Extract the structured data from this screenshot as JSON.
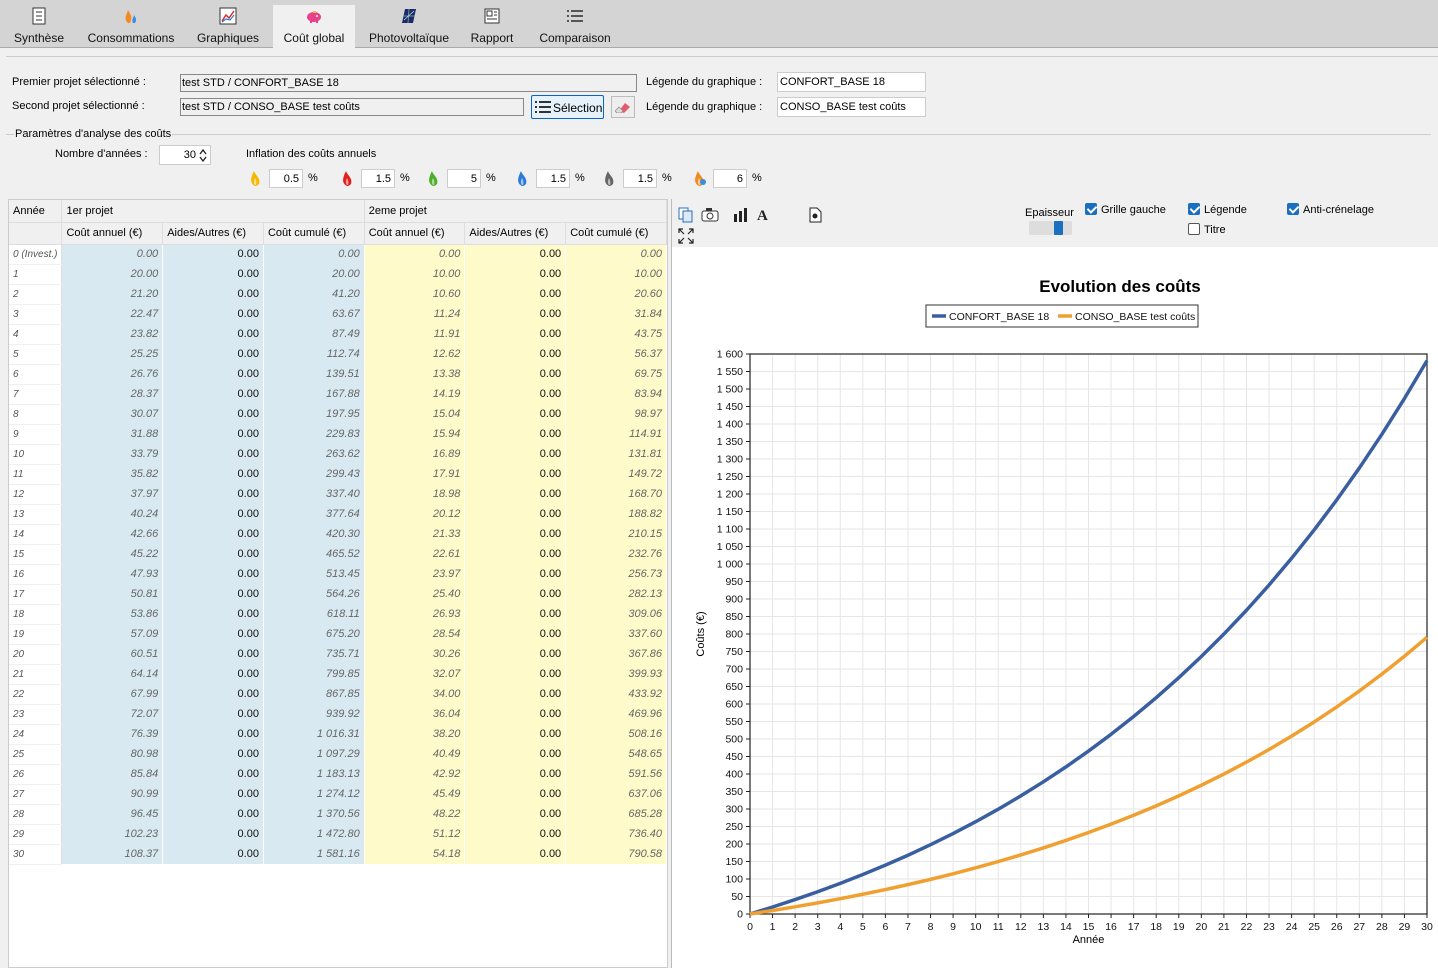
{
  "tabs": [
    {
      "label": "Synthèse",
      "icon": "synthese-icon"
    },
    {
      "label": "Consommations",
      "icon": "flames-icon"
    },
    {
      "label": "Graphiques",
      "icon": "chart-icon"
    },
    {
      "label": "Coût global",
      "icon": "piggy-bank-icon",
      "active": true
    },
    {
      "label": "Photovoltaïque",
      "icon": "solar-panel-icon"
    },
    {
      "label": "Rapport",
      "icon": "report-icon"
    },
    {
      "label": "Comparaison",
      "icon": "list-icon"
    }
  ],
  "projects": {
    "first_label": "Premier projet sélectionné :",
    "first_value": "test STD / CONFORT_BASE 18",
    "second_label": "Second projet sélectionné :",
    "second_value": "test STD / CONSO_BASE test coûts",
    "selection_button": "Sélection",
    "legend_label_1": "Légende du graphique :",
    "legend_value_1": "CONFORT_BASE 18",
    "legend_label_2": "Légende du graphique :",
    "legend_value_2": "CONSO_BASE test coûts"
  },
  "params": {
    "group_title": "Paramètres d'analyse des coûts",
    "years_label": "Nombre d'années :",
    "years_value": "30",
    "inflation_label": "Inflation des coûts annuels",
    "pct": "%",
    "inflations": [
      {
        "value": "0.5",
        "icon": "flame-yellow-icon",
        "color": "#f5b800"
      },
      {
        "value": "1.5",
        "icon": "flame-red-icon",
        "color": "#e02020"
      },
      {
        "value": "5",
        "icon": "flame-green-icon",
        "color": "#4caf2a"
      },
      {
        "value": "1.5",
        "icon": "flame-blue-icon",
        "color": "#2e7bd6"
      },
      {
        "value": "1.5",
        "icon": "flame-grey-icon",
        "color": "#666666"
      },
      {
        "value": "6",
        "icon": "flame-orange-blue-icon",
        "color": "#f08a20"
      }
    ]
  },
  "table": {
    "group_headers": {
      "year": "Année",
      "p1": "1er projet",
      "p2": "2eme projet"
    },
    "headers": [
      "Coût annuel (€)",
      "Aides/Autres (€)",
      "Coût cumulé (€)",
      "Coût annuel (€)",
      "Aides/Autres (€)",
      "Coût cumulé (€)"
    ],
    "rows": [
      [
        "0 (Invest.)",
        "0.00",
        "0.00",
        "0.00",
        "0.00",
        "0.00",
        "0.00"
      ],
      [
        "1",
        "20.00",
        "0.00",
        "20.00",
        "10.00",
        "0.00",
        "10.00"
      ],
      [
        "2",
        "21.20",
        "0.00",
        "41.20",
        "10.60",
        "0.00",
        "20.60"
      ],
      [
        "3",
        "22.47",
        "0.00",
        "63.67",
        "11.24",
        "0.00",
        "31.84"
      ],
      [
        "4",
        "23.82",
        "0.00",
        "87.49",
        "11.91",
        "0.00",
        "43.75"
      ],
      [
        "5",
        "25.25",
        "0.00",
        "112.74",
        "12.62",
        "0.00",
        "56.37"
      ],
      [
        "6",
        "26.76",
        "0.00",
        "139.51",
        "13.38",
        "0.00",
        "69.75"
      ],
      [
        "7",
        "28.37",
        "0.00",
        "167.88",
        "14.19",
        "0.00",
        "83.94"
      ],
      [
        "8",
        "30.07",
        "0.00",
        "197.95",
        "15.04",
        "0.00",
        "98.97"
      ],
      [
        "9",
        "31.88",
        "0.00",
        "229.83",
        "15.94",
        "0.00",
        "114.91"
      ],
      [
        "10",
        "33.79",
        "0.00",
        "263.62",
        "16.89",
        "0.00",
        "131.81"
      ],
      [
        "11",
        "35.82",
        "0.00",
        "299.43",
        "17.91",
        "0.00",
        "149.72"
      ],
      [
        "12",
        "37.97",
        "0.00",
        "337.40",
        "18.98",
        "0.00",
        "168.70"
      ],
      [
        "13",
        "40.24",
        "0.00",
        "377.64",
        "20.12",
        "0.00",
        "188.82"
      ],
      [
        "14",
        "42.66",
        "0.00",
        "420.30",
        "21.33",
        "0.00",
        "210.15"
      ],
      [
        "15",
        "45.22",
        "0.00",
        "465.52",
        "22.61",
        "0.00",
        "232.76"
      ],
      [
        "16",
        "47.93",
        "0.00",
        "513.45",
        "23.97",
        "0.00",
        "256.73"
      ],
      [
        "17",
        "50.81",
        "0.00",
        "564.26",
        "25.40",
        "0.00",
        "282.13"
      ],
      [
        "18",
        "53.86",
        "0.00",
        "618.11",
        "26.93",
        "0.00",
        "309.06"
      ],
      [
        "19",
        "57.09",
        "0.00",
        "675.20",
        "28.54",
        "0.00",
        "337.60"
      ],
      [
        "20",
        "60.51",
        "0.00",
        "735.71",
        "30.26",
        "0.00",
        "367.86"
      ],
      [
        "21",
        "64.14",
        "0.00",
        "799.85",
        "32.07",
        "0.00",
        "399.93"
      ],
      [
        "22",
        "67.99",
        "0.00",
        "867.85",
        "34.00",
        "0.00",
        "433.92"
      ],
      [
        "23",
        "72.07",
        "0.00",
        "939.92",
        "36.04",
        "0.00",
        "469.96"
      ],
      [
        "24",
        "76.39",
        "0.00",
        "1 016.31",
        "38.20",
        "0.00",
        "508.16"
      ],
      [
        "25",
        "80.98",
        "0.00",
        "1 097.29",
        "40.49",
        "0.00",
        "548.65"
      ],
      [
        "26",
        "85.84",
        "0.00",
        "1 183.13",
        "42.92",
        "0.00",
        "591.56"
      ],
      [
        "27",
        "90.99",
        "0.00",
        "1 274.12",
        "45.49",
        "0.00",
        "637.06"
      ],
      [
        "28",
        "96.45",
        "0.00",
        "1 370.56",
        "48.22",
        "0.00",
        "685.28"
      ],
      [
        "29",
        "102.23",
        "0.00",
        "1 472.80",
        "51.12",
        "0.00",
        "736.40"
      ],
      [
        "30",
        "108.37",
        "0.00",
        "1 581.16",
        "54.18",
        "0.00",
        "790.58"
      ]
    ]
  },
  "chart_toolbar": {
    "thickness_label": "Epaisseur",
    "grid_left": "Grille gauche",
    "legend": "Légende",
    "title": "Titre",
    "antialias": "Anti-crénelage",
    "grid_left_on": true,
    "legend_on": true,
    "title_on": false,
    "antialias_on": true
  },
  "chart_data": {
    "type": "line",
    "title": "Evolution des coûts",
    "xlabel": "Année",
    "ylabel": "Coûts (€)",
    "x": [
      0,
      1,
      2,
      3,
      4,
      5,
      6,
      7,
      8,
      9,
      10,
      11,
      12,
      13,
      14,
      15,
      16,
      17,
      18,
      19,
      20,
      21,
      22,
      23,
      24,
      25,
      26,
      27,
      28,
      29,
      30
    ],
    "ylim": [
      0,
      1600
    ],
    "ytick_step": 50,
    "grid": true,
    "legend": "top-center",
    "series": [
      {
        "name": "CONFORT_BASE 18",
        "color": "#3a5fa0",
        "values": [
          0,
          20,
          41.2,
          63.67,
          87.49,
          112.74,
          139.51,
          167.88,
          197.95,
          229.83,
          263.62,
          299.43,
          337.4,
          377.64,
          420.3,
          465.52,
          513.45,
          564.26,
          618.11,
          675.2,
          735.71,
          799.85,
          867.85,
          939.92,
          1016.31,
          1097.29,
          1183.13,
          1274.12,
          1370.56,
          1472.8,
          1581.16
        ]
      },
      {
        "name": "CONSO_BASE test coûts",
        "color": "#f0a030",
        "values": [
          0,
          10,
          20.6,
          31.84,
          43.75,
          56.37,
          69.75,
          83.94,
          98.97,
          114.91,
          131.81,
          149.72,
          168.7,
          188.82,
          210.15,
          232.76,
          256.73,
          282.13,
          309.06,
          337.6,
          367.86,
          399.93,
          433.92,
          469.96,
          508.16,
          548.65,
          591.56,
          637.06,
          685.28,
          736.4,
          790.58
        ]
      }
    ]
  }
}
